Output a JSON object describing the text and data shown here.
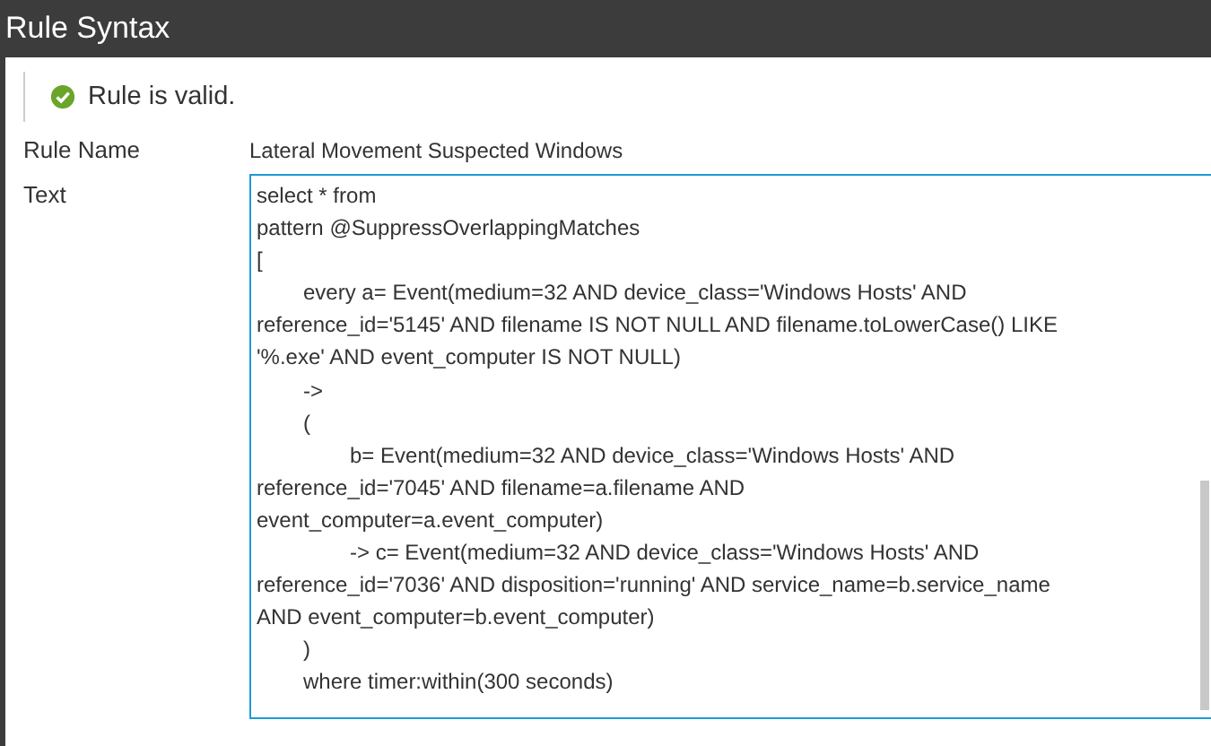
{
  "window": {
    "title": "Rule Syntax"
  },
  "status": {
    "kind": "valid",
    "message": "Rule is valid."
  },
  "fields": [
    {
      "label": "Rule Name",
      "value": "Lateral Movement Suspected Windows"
    },
    {
      "label": "Text"
    }
  ],
  "rule_text": [
    "select * from",
    "pattern @SuppressOverlappingMatches",
    "[",
    "\tevery a= Event(medium=32 AND device_class='Windows Hosts' AND",
    "reference_id='5145' AND filename IS NOT NULL AND filename.toLowerCase() LIKE",
    "'%.exe' AND event_computer IS NOT NULL)",
    "\t->",
    "\t(",
    "\t\tb= Event(medium=32 AND device_class='Windows Hosts' AND",
    "reference_id='7045' AND filename=a.filename AND",
    "event_computer=a.event_computer)",
    "\t\t-> c= Event(medium=32 AND device_class='Windows Hosts' AND",
    "reference_id='7036' AND disposition='running' AND service_name=b.service_name",
    "AND event_computer=b.event_computer)",
    "\t)",
    "\twhere timer:within(300 seconds)"
  ]
}
